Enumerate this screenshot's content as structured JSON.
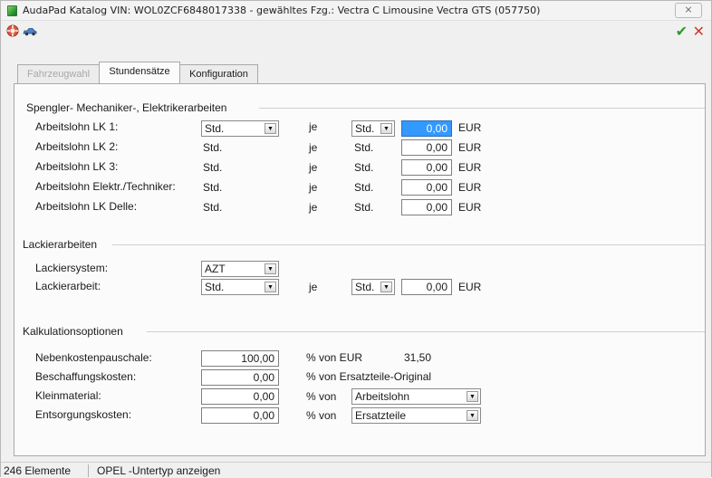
{
  "window": {
    "title": "AudaPad Katalog  VIN: WOL0ZCF6848017338 - gewähltes Fzg.: Vectra C Limousine Vectra GTS (057750)",
    "close_label": "⨯"
  },
  "toolbar": {
    "left_icons": [
      "lifebuoy-icon",
      "car-icon"
    ],
    "confirm_label": "✔",
    "cancel_label": "✕"
  },
  "tabs": [
    {
      "label": "Fahrzeugwahl",
      "state": "disabled"
    },
    {
      "label": "Stundensätze",
      "state": "active"
    },
    {
      "label": "Konfiguration",
      "state": "normal"
    }
  ],
  "section1": {
    "title": "Spengler- Mechaniker-, Elektrikerarbeiten",
    "rows": [
      {
        "label": "Arbeitslohn LK 1:",
        "unit1": "Std.",
        "je": "je",
        "unit2": "Std.",
        "value": "0,00",
        "currency": "EUR"
      },
      {
        "label": "Arbeitslohn LK 2:",
        "unit1": "Std.",
        "je": "je",
        "unit2": "Std.",
        "value": "0,00",
        "currency": "EUR"
      },
      {
        "label": "Arbeitslohn LK 3:",
        "unit1": "Std.",
        "je": "je",
        "unit2": "Std.",
        "value": "0,00",
        "currency": "EUR"
      },
      {
        "label": "Arbeitslohn Elektr./Techniker:",
        "unit1": "Std.",
        "je": "je",
        "unit2": "Std.",
        "value": "0,00",
        "currency": "EUR"
      },
      {
        "label": "Arbeitslohn LK Delle:",
        "unit1": "Std.",
        "je": "je",
        "unit2": "Std.",
        "value": "0,00",
        "currency": "EUR"
      }
    ]
  },
  "section2": {
    "title": "Lackierarbeiten",
    "system_label": "Lackiersystem:",
    "system_value": "AZT",
    "work_label": "Lackierarbeit:",
    "work_unit1": "Std.",
    "work_je": "je",
    "work_unit2": "Std.",
    "work_value": "0,00",
    "work_currency": "EUR"
  },
  "section3": {
    "title": "Kalkulationsoptionen",
    "rows": [
      {
        "label": "Nebenkostenpauschale:",
        "value": "100,00",
        "suffix": "% von EUR",
        "extra": "31,50"
      },
      {
        "label": "Beschaffungskosten:",
        "value": "0,00",
        "suffix": "% von Ersatzteile-Original"
      },
      {
        "label": "Kleinmaterial:",
        "value": "0,00",
        "suffix": "% von",
        "select": "Arbeitslohn"
      },
      {
        "label": "Entsorgungskosten:",
        "value": "0,00",
        "suffix": "% von",
        "select": "Ersatzteile"
      }
    ]
  },
  "status": {
    "count": "246 Elemente",
    "text": "OPEL -Untertyp anzeigen"
  }
}
